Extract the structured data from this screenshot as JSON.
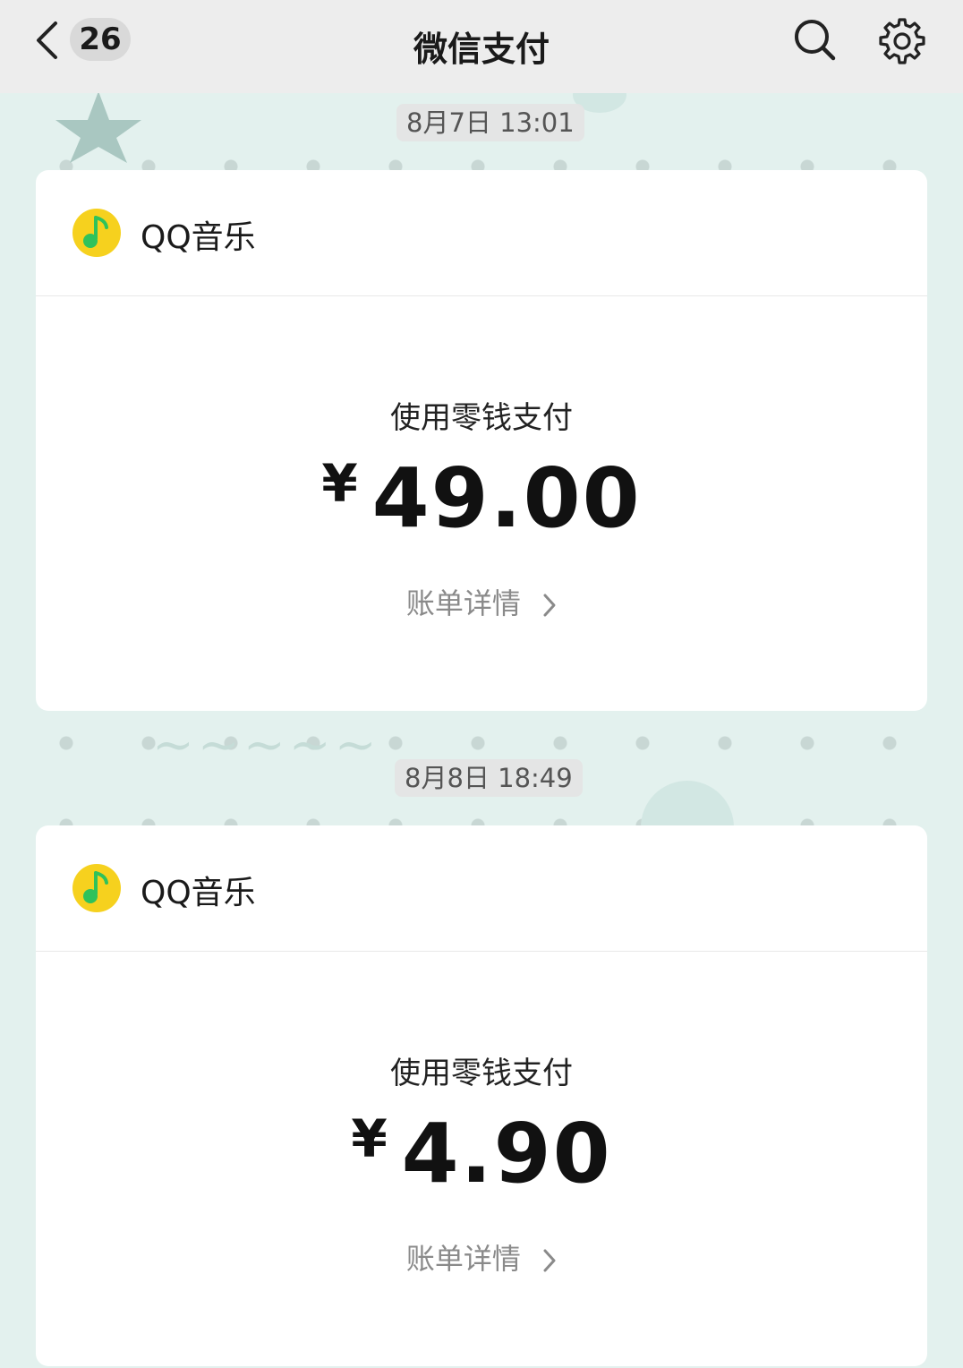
{
  "header": {
    "unread_count": "26",
    "title": "微信支付",
    "back_icon": "chevron-left-icon",
    "search_icon": "search-icon",
    "settings_icon": "gear-icon"
  },
  "messages": [
    {
      "timestamp": "8月7日 13:01",
      "app_name": "QQ音乐",
      "pay_method": "使用零钱支付",
      "currency": "¥",
      "amount": "49.00",
      "details_label": "账单详情"
    },
    {
      "timestamp": "8月8日 18:49",
      "app_name": "QQ音乐",
      "pay_method": "使用零钱支付",
      "currency": "¥",
      "amount": "4.90",
      "details_label": "账单详情"
    }
  ],
  "colors": {
    "accent_green": "#2fc25b",
    "logo_yellow": "#f6d11e",
    "background": "#e3f1ee"
  }
}
